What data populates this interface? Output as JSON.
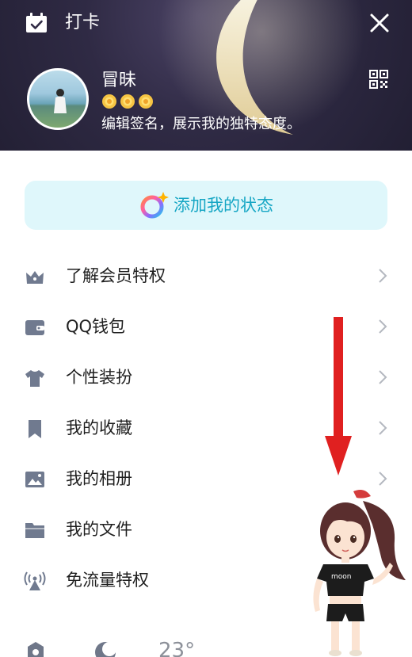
{
  "header": {
    "checkin_label": "打卡",
    "username": "冒昧",
    "badge_count": 3,
    "signature": "编辑签名，展示我的独特态度。"
  },
  "status_button": {
    "label": "添加我的状态"
  },
  "menu": {
    "items": [
      {
        "label": "了解会员特权",
        "icon": "crown-icon",
        "has_chevron": true
      },
      {
        "label": "QQ钱包",
        "icon": "wallet-icon",
        "has_chevron": true
      },
      {
        "label": "个性装扮",
        "icon": "tshirt-icon",
        "has_chevron": true
      },
      {
        "label": "我的收藏",
        "icon": "bookmark-icon",
        "has_chevron": true
      },
      {
        "label": "我的相册",
        "icon": "photo-icon",
        "has_chevron": true
      },
      {
        "label": "我的文件",
        "icon": "folder-icon",
        "has_chevron": false
      },
      {
        "label": "免流量特权",
        "icon": "signal-tower-icon",
        "has_chevron": false
      }
    ]
  },
  "bottom_bar": {
    "weather_temp": "23°"
  },
  "colors": {
    "header_bg": "#2f2a44",
    "status_bg": "#dff7fb",
    "status_text": "#16a6c4",
    "icon_gray": "#707a8f",
    "arrow_red": "#e02020"
  }
}
